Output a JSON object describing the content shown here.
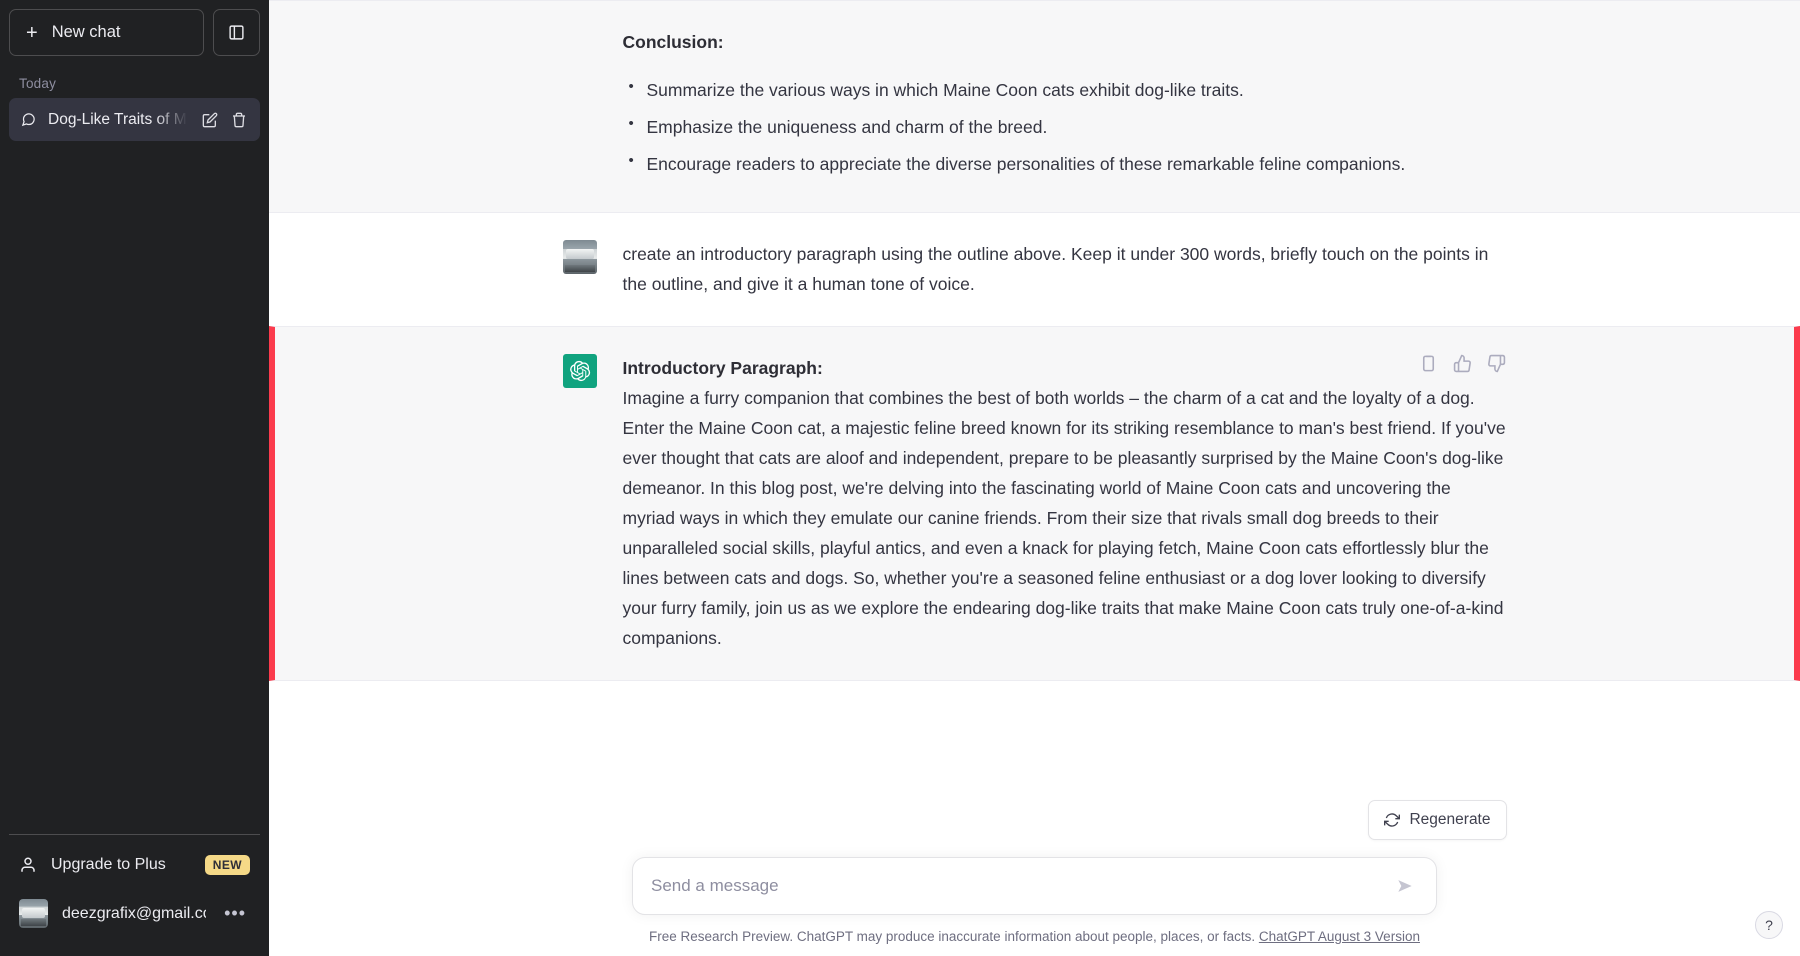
{
  "sidebar": {
    "new_chat_label": "New chat",
    "new_chat_icon": "plus-icon",
    "collapse_icon": "sidebar-collapse-icon",
    "section_label": "Today",
    "chats": [
      {
        "title": "Dog-Like Traits of Main",
        "icon": "chat-bubble-icon",
        "edit_icon": "pencil-icon",
        "delete_icon": "trash-icon"
      }
    ],
    "upgrade": {
      "label": "Upgrade to Plus",
      "icon": "person-icon",
      "badge": "NEW"
    },
    "account": {
      "email": "deezgrafix@gmail.com",
      "avatar": "user-photo-avatar",
      "menu_icon": "ellipsis-icon"
    }
  },
  "thread": {
    "outline_turn": {
      "heading": "Conclusion:",
      "bullets": [
        "Summarize the various ways in which Maine Coon cats exhibit dog-like traits.",
        "Emphasize the uniqueness and charm of the breed.",
        "Encourage readers to appreciate the diverse personalities of these remarkable feline companions."
      ]
    },
    "user_turn": {
      "avatar": "user-photo-avatar",
      "text": "create an introductory paragraph using the outline above. Keep it under 300 words, briefly touch on the points in the outline, and give it a human tone of voice."
    },
    "assistant_turn": {
      "avatar": "chatgpt-logo-icon",
      "title": "Introductory Paragraph:",
      "paragraph": "Imagine a furry companion that combines the best of both worlds – the charm of a cat and the loyalty of a dog. Enter the Maine Coon cat, a majestic feline breed known for its striking resemblance to man's best friend. If you've ever thought that cats are aloof and independent, prepare to be pleasantly surprised by the Maine Coon's dog-like demeanor. In this blog post, we're delving into the fascinating world of Maine Coon cats and uncovering the myriad ways in which they emulate our canine friends. From their size that rivals small dog breeds to their unparalleled social skills, playful antics, and even a knack for playing fetch, Maine Coon cats effortlessly blur the lines between cats and dogs. So, whether you're a seasoned feline enthusiast or a dog lover looking to diversify your furry family, join us as we explore the endearing dog-like traits that make Maine Coon cats truly one-of-a-kind companions.",
      "actions": [
        {
          "name": "copy-icon"
        },
        {
          "name": "thumbs-up-icon"
        },
        {
          "name": "thumbs-down-icon"
        }
      ],
      "highlight_color": "#fb3b4d"
    }
  },
  "composer": {
    "regenerate_label": "Regenerate",
    "regenerate_icon": "refresh-icon",
    "placeholder": "Send a message",
    "value": "",
    "send_icon": "send-arrow-icon"
  },
  "footer": {
    "disclaimer": "Free Research Preview. ChatGPT may produce inaccurate information about people, places, or facts.",
    "version_link": "ChatGPT August 3 Version"
  },
  "help": {
    "label": "?",
    "icon": "question-mark-icon"
  },
  "colors": {
    "sidebar_bg": "#202123",
    "accent_green": "#10a37f",
    "highlight_red": "#fb3b4d",
    "badge_yellow": "#f5d987"
  }
}
